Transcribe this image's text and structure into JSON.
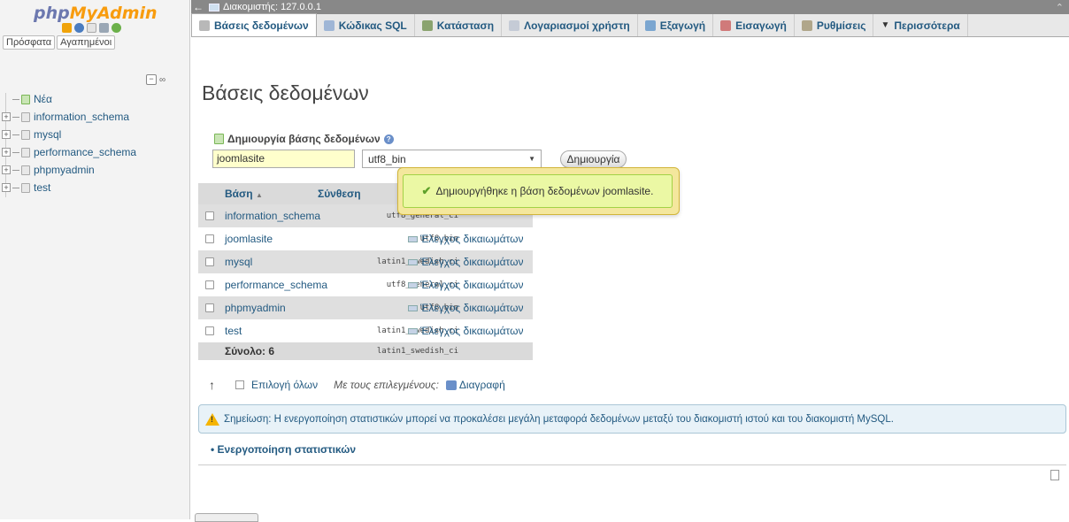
{
  "sidebar": {
    "logo_part1": "php",
    "logo_part2": "MyAdmin",
    "tabs": [
      "Πρόσφατα",
      "Αγαπημένοι"
    ],
    "items": [
      {
        "label": "Νέα"
      },
      {
        "label": "information_schema"
      },
      {
        "label": "mysql"
      },
      {
        "label": "performance_schema"
      },
      {
        "label": "phpmyadmin"
      },
      {
        "label": "test"
      }
    ]
  },
  "topbar": {
    "server": "Διακομιστής: 127.0.0.1"
  },
  "menu": {
    "tabs": [
      {
        "label": "Βάσεις δεδομένων",
        "icon": "database-icon"
      },
      {
        "label": "Κώδικας SQL",
        "icon": "sql-icon"
      },
      {
        "label": "Κατάσταση",
        "icon": "status-icon"
      },
      {
        "label": "Λογαριασμοί χρήστη",
        "icon": "users-icon"
      },
      {
        "label": "Εξαγωγή",
        "icon": "export-icon"
      },
      {
        "label": "Εισαγωγή",
        "icon": "import-icon"
      },
      {
        "label": "Ρυθμίσεις",
        "icon": "wrench-icon"
      },
      {
        "label": "Περισσότερα",
        "icon": "triangle-down-icon"
      }
    ]
  },
  "main": {
    "title": "Βάσεις δεδομένων",
    "create_heading": "Δημιουργία βάσης δεδομένων",
    "db_name_value": "joomlasite",
    "collation_value": "utf8_bin",
    "create_button": "Δημιουργία",
    "success_message": "Δημιουργήθηκε η βάση δεδομένων joomlasite.",
    "table": {
      "col_db": "Βάση",
      "sort_arrow": "▲",
      "col_collation": "Σύνθεση",
      "privileges_label": "Έλεγχος δικαιωμάτων",
      "rows": [
        {
          "name": "information_schema",
          "collation": "utf8_general_ci"
        },
        {
          "name": "joomlasite",
          "collation": "utf8_bin"
        },
        {
          "name": "mysql",
          "collation": "latin1_swedish_ci"
        },
        {
          "name": "performance_schema",
          "collation": "utf8_general_ci"
        },
        {
          "name": "phpmyadmin",
          "collation": "utf8_bin"
        },
        {
          "name": "test",
          "collation": "latin1_swedish_ci"
        }
      ],
      "total_label": "Σύνολο: 6",
      "total_collation": "latin1_swedish_ci"
    },
    "select_all": "Επιλογή όλων",
    "with_selected": "Με τους επιλεγμένους:",
    "delete": "Διαγραφή",
    "notice": "Σημείωση: Η ενεργοποίηση στατιστικών μπορεί να προκαλέσει μεγάλη μεταφορά δεδομένων μεταξύ του διακομιστή ιστού και του διακομιστή MySQL.",
    "enable_stats": "Ενεργοποίηση στατιστικών"
  }
}
